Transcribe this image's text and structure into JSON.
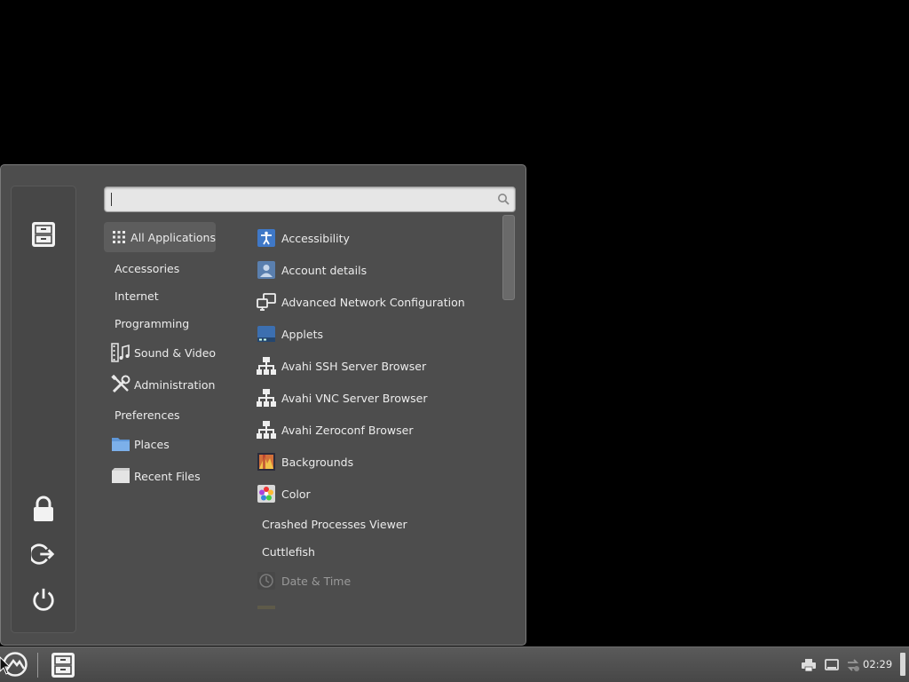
{
  "search": {
    "placeholder": "",
    "value": ""
  },
  "categories": [
    {
      "label": "All Applications",
      "icon": "grid-icon"
    },
    {
      "label": "Accessories",
      "icon": ""
    },
    {
      "label": "Internet",
      "icon": ""
    },
    {
      "label": "Programming",
      "icon": ""
    },
    {
      "label": "Sound & Video",
      "icon": "film-music-icon"
    },
    {
      "label": "Administration",
      "icon": "tools-icon"
    },
    {
      "label": "Preferences",
      "icon": ""
    },
    {
      "label": "Places",
      "icon": "folder-icon"
    },
    {
      "label": "Recent Files",
      "icon": "document-icon"
    }
  ],
  "apps": [
    {
      "label": "Accessibility",
      "icon": "accessibility-icon"
    },
    {
      "label": "Account details",
      "icon": "account-icon"
    },
    {
      "label": "Advanced Network Configuration",
      "icon": "network-icon"
    },
    {
      "label": "Applets",
      "icon": "applets-icon"
    },
    {
      "label": "Avahi SSH Server Browser",
      "icon": "network-tree-icon"
    },
    {
      "label": "Avahi VNC Server Browser",
      "icon": "network-tree-icon"
    },
    {
      "label": "Avahi Zeroconf Browser",
      "icon": "network-tree-icon"
    },
    {
      "label": "Backgrounds",
      "icon": "backgrounds-icon"
    },
    {
      "label": "Color",
      "icon": "color-icon"
    },
    {
      "label": "Crashed Processes Viewer",
      "icon": ""
    },
    {
      "label": "Cuttlefish",
      "icon": ""
    },
    {
      "label": "Date & Time",
      "icon": "clock-icon"
    }
  ],
  "taskbar": {
    "clock": "02:29"
  },
  "colors": {
    "menu_bg": "#4d4d4d",
    "accent_selected": "#5d5d5d",
    "taskbar": "#4f4f4f"
  }
}
